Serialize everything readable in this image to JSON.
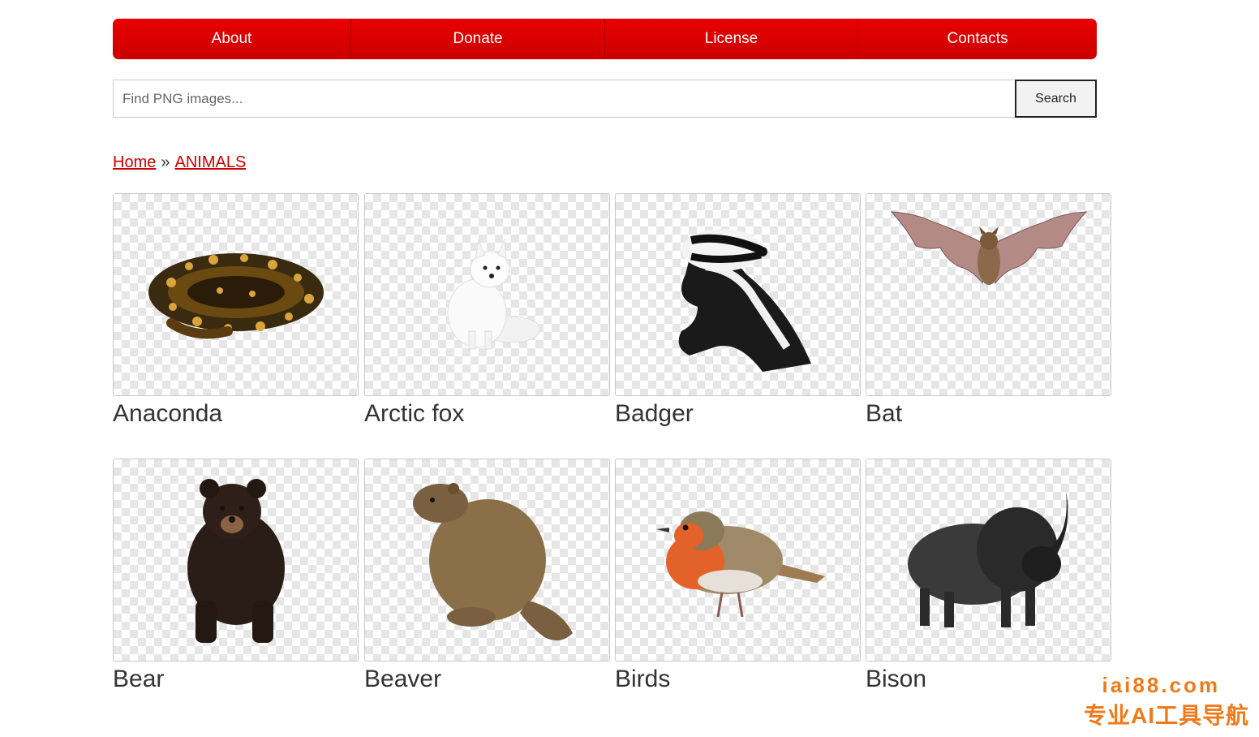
{
  "nav": {
    "items": [
      {
        "label": "About"
      },
      {
        "label": "Donate"
      },
      {
        "label": "License"
      },
      {
        "label": "Contacts"
      }
    ]
  },
  "search": {
    "placeholder": "Find PNG images...",
    "value": "",
    "button_label": "Search"
  },
  "breadcrumb": {
    "home": "Home",
    "separator": "»",
    "current": "ANIMALS"
  },
  "grid": {
    "items": [
      {
        "label": "Anaconda",
        "icon": "anaconda-image"
      },
      {
        "label": "Arctic fox",
        "icon": "arctic-fox-image"
      },
      {
        "label": "Badger",
        "icon": "badger-image"
      },
      {
        "label": "Bat",
        "icon": "bat-image"
      },
      {
        "label": "Bear",
        "icon": "bear-image"
      },
      {
        "label": "Beaver",
        "icon": "beaver-image"
      },
      {
        "label": "Birds",
        "icon": "bird-image"
      },
      {
        "label": "Bison",
        "icon": "bison-image"
      }
    ]
  },
  "watermark": {
    "line1": "iai88.com",
    "line2": "专业AI工具导航"
  },
  "colors": {
    "nav": "#e00000",
    "link": "#cc0000",
    "watermark": "#f07a1a"
  }
}
